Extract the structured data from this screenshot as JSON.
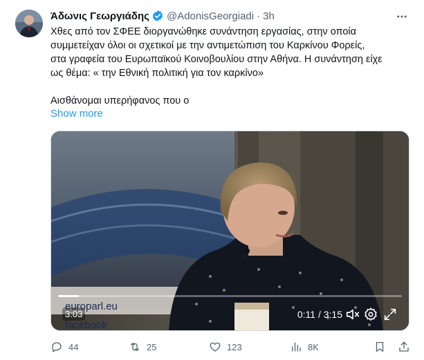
{
  "author": {
    "display_name": "Άδωνις Γεωργιάδης",
    "handle": "@AdonisGeorgiadi",
    "separator": "·",
    "time": "3h",
    "verified": true
  },
  "tweet": {
    "lines": [
      "Χθες από τον ΣΦΕΕ διοργανώθηκε συνάντηση εργασίας, στην οποία",
      "συμμετείχαν όλοι οι σχετικοί με την αντιμετώπιση του Καρκίνου Φορείς,",
      "στα γραφεία του Ευρωπαϊκού Κοινοβουλίου στην Αθήνα. Η συνάντηση είχε",
      "ως θέμα: « την Εθνική πολιτική για τον καρκίνο»",
      "Αισθάνομαι υπερήφανος που ο"
    ],
    "show_more": "Show more"
  },
  "video": {
    "elapsed_badge": "3:03",
    "time_display": "0:11 / 3:15",
    "progress": 0.06,
    "backdrop_text": "europarl.eu",
    "backdrop_text_2": "facebook"
  },
  "actions": {
    "replies": "44",
    "retweets": "25",
    "likes": "123",
    "views": "8K"
  },
  "colors": {
    "accent": "#1d9bf0",
    "muted": "#536471"
  },
  "icons": {
    "verified": "verified-badge-icon",
    "more": "more-icon",
    "reply": "reply-icon",
    "retweet": "retweet-icon",
    "like": "heart-icon",
    "views": "views-icon",
    "bookmark": "bookmark-icon",
    "share": "share-icon",
    "mute": "mute-icon",
    "settings": "settings-icon",
    "fullscreen": "fullscreen-icon"
  }
}
